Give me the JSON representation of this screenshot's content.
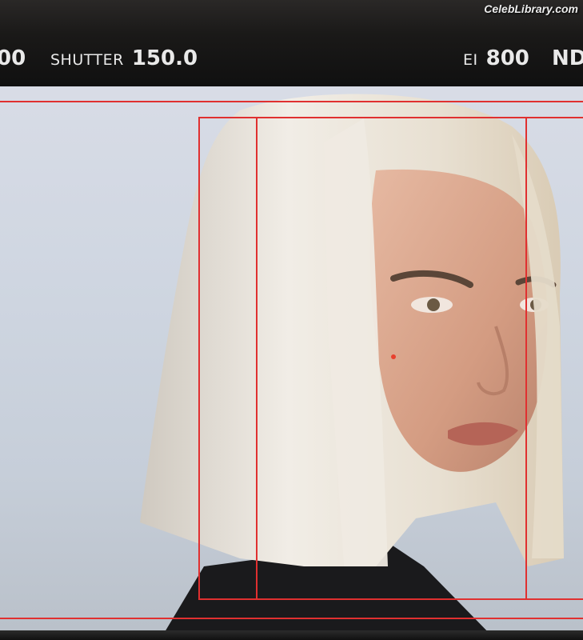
{
  "watermark": "CelebLibrary.com",
  "monitor": {
    "left_fragment": {
      "value": "00"
    },
    "shutter": {
      "label": "SHUTTER",
      "value": "150.0"
    },
    "ei": {
      "label": "EI",
      "value": "800"
    },
    "nd": {
      "label": "ND"
    }
  },
  "colors": {
    "overlay_lines": "#e03030",
    "background": "#cfd6e1",
    "hair": "#ece6da",
    "skin": "#d9a58c",
    "clothing": "#1a1a1c"
  }
}
